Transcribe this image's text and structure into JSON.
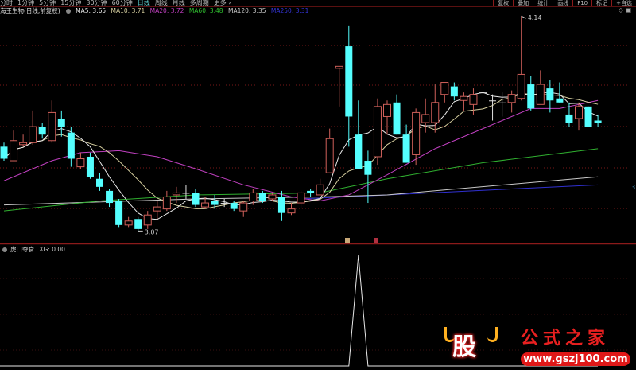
{
  "topbar": {
    "tabs": [
      "分时",
      "1分钟",
      "5分钟",
      "15分钟",
      "30分钟",
      "60分钟",
      "日线",
      "周线",
      "月线",
      "多周期",
      "更多 ›"
    ],
    "active_tab": "日线",
    "tools": [
      "复权",
      "叠加",
      "统计",
      "画线",
      "F10",
      "标记",
      "+自选"
    ]
  },
  "legend": {
    "title": "海王生物(日线,前复权)",
    "ma5": "MA5: 3.65",
    "ma10": "MA10: 3.71",
    "ma20": "MA20: 3.72",
    "ma60": "MA60: 3.48",
    "ma120": "MA120: 3.35",
    "ma250": "MA250: 3.31"
  },
  "colors": {
    "up": "#d0605a",
    "down": "#54ffff",
    "ma5": "#e8e8e8",
    "ma10": "#d8d0a0",
    "ma20": "#c040c0",
    "ma60": "#30b030",
    "ma120": "#c8c8c8",
    "ma250": "#3030d0",
    "grid": "#7a1818"
  },
  "sub_indicator": {
    "title": "虎口夺食",
    "value_label": "XG: 0.00"
  },
  "axis_label_right": "3",
  "watermark": {
    "char": "股",
    "name": "公式之家",
    "url": "www.gszj100.com"
  },
  "chart_data": {
    "type": "candlestick",
    "title": "海王生物(日线,前复权)",
    "ylim": [
      3.0,
      4.2
    ],
    "annotations": [
      {
        "text": "4.14",
        "candle": 54,
        "value": 4.14,
        "kind": "high"
      },
      {
        "text": "3.07",
        "candle": 14,
        "value": 3.07,
        "kind": "low"
      }
    ],
    "ohlc": [
      [
        3.49,
        3.51,
        3.42,
        3.43
      ],
      [
        3.42,
        3.57,
        3.42,
        3.52
      ],
      [
        3.5,
        3.55,
        3.49,
        3.51
      ],
      [
        3.51,
        3.67,
        3.5,
        3.59
      ],
      [
        3.59,
        3.61,
        3.53,
        3.55
      ],
      [
        3.52,
        3.72,
        3.51,
        3.66
      ],
      [
        3.63,
        3.67,
        3.54,
        3.59
      ],
      [
        3.56,
        3.59,
        3.39,
        3.43
      ],
      [
        3.39,
        3.46,
        3.38,
        3.43
      ],
      [
        3.44,
        3.46,
        3.33,
        3.34
      ],
      [
        3.33,
        3.36,
        3.27,
        3.29
      ],
      [
        3.27,
        3.28,
        3.19,
        3.21
      ],
      [
        3.22,
        3.23,
        3.09,
        3.1
      ],
      [
        3.1,
        3.14,
        3.09,
        3.12
      ],
      [
        3.13,
        3.14,
        3.07,
        3.08
      ],
      [
        3.1,
        3.17,
        3.08,
        3.15
      ],
      [
        3.17,
        3.22,
        3.13,
        3.19
      ],
      [
        3.18,
        3.27,
        3.17,
        3.24
      ],
      [
        3.25,
        3.29,
        3.21,
        3.26
      ],
      [
        3.26,
        3.3,
        3.23,
        3.26
      ],
      [
        3.26,
        3.28,
        3.19,
        3.2
      ],
      [
        3.19,
        3.24,
        3.18,
        3.21
      ],
      [
        3.22,
        3.25,
        3.18,
        3.2
      ],
      [
        3.21,
        3.23,
        3.19,
        3.21
      ],
      [
        3.21,
        3.22,
        3.17,
        3.18
      ],
      [
        3.17,
        3.22,
        3.14,
        3.21
      ],
      [
        3.22,
        3.28,
        3.2,
        3.26
      ],
      [
        3.26,
        3.27,
        3.21,
        3.22
      ],
      [
        3.23,
        3.26,
        3.22,
        3.25
      ],
      [
        3.24,
        3.27,
        3.12,
        3.16
      ],
      [
        3.16,
        3.21,
        3.15,
        3.18
      ],
      [
        3.21,
        3.27,
        3.18,
        3.26
      ],
      [
        3.27,
        3.28,
        3.24,
        3.26
      ],
      [
        3.25,
        3.33,
        3.25,
        3.3
      ],
      [
        3.36,
        3.58,
        3.36,
        3.53
      ],
      [
        3.88,
        3.89,
        3.69,
        3.89
      ],
      [
        3.99,
        4.09,
        3.49,
        3.64
      ],
      [
        3.55,
        3.72,
        3.38,
        3.38
      ],
      [
        3.42,
        3.47,
        3.21,
        3.35
      ],
      [
        3.44,
        3.73,
        3.4,
        3.69
      ],
      [
        3.64,
        3.72,
        3.55,
        3.7
      ],
      [
        3.71,
        3.75,
        3.55,
        3.55
      ],
      [
        3.55,
        3.6,
        3.41,
        3.41
      ],
      [
        3.45,
        3.68,
        3.4,
        3.66
      ],
      [
        3.61,
        3.73,
        3.56,
        3.65
      ],
      [
        3.61,
        3.8,
        3.56,
        3.71
      ],
      [
        3.75,
        3.81,
        3.71,
        3.81
      ],
      [
        3.79,
        3.81,
        3.72,
        3.74
      ],
      [
        3.72,
        3.76,
        3.67,
        3.74
      ],
      [
        3.7,
        3.78,
        3.65,
        3.75
      ],
      [
        3.76,
        3.84,
        3.68,
        3.76
      ],
      [
        3.72,
        3.75,
        3.62,
        3.72
      ],
      [
        3.71,
        3.76,
        3.64,
        3.71
      ],
      [
        3.71,
        3.77,
        3.66,
        3.75
      ],
      [
        3.73,
        4.14,
        3.72,
        3.85
      ],
      [
        3.8,
        3.84,
        3.67,
        3.68
      ],
      [
        3.7,
        3.87,
        3.7,
        3.8
      ],
      [
        3.78,
        3.82,
        3.66,
        3.72
      ],
      [
        3.73,
        3.81,
        3.71,
        3.71
      ],
      [
        3.65,
        3.71,
        3.59,
        3.61
      ],
      [
        3.63,
        3.71,
        3.57,
        3.69
      ],
      [
        3.69,
        3.69,
        3.59,
        3.59
      ],
      [
        3.62,
        3.65,
        3.59,
        3.61
      ]
    ],
    "ma_series": {
      "ma20": [
        [
          0,
          3.32
        ],
        [
          5,
          3.42
        ],
        [
          8,
          3.46
        ],
        [
          12,
          3.47
        ],
        [
          16,
          3.44
        ],
        [
          20,
          3.38
        ],
        [
          25,
          3.3
        ],
        [
          30,
          3.24
        ],
        [
          33,
          3.22
        ],
        [
          36,
          3.25
        ],
        [
          40,
          3.35
        ],
        [
          45,
          3.48
        ],
        [
          50,
          3.58
        ],
        [
          55,
          3.68
        ],
        [
          58,
          3.68
        ],
        [
          62,
          3.72
        ]
      ],
      "ma60": [
        [
          0,
          3.17
        ],
        [
          10,
          3.22
        ],
        [
          20,
          3.25
        ],
        [
          33,
          3.26
        ],
        [
          40,
          3.33
        ],
        [
          50,
          3.41
        ],
        [
          62,
          3.48
        ]
      ],
      "ma120": [
        [
          0,
          3.2
        ],
        [
          20,
          3.23
        ],
        [
          33,
          3.24
        ],
        [
          40,
          3.25
        ],
        [
          62,
          3.34
        ]
      ],
      "ma250": [
        [
          31,
          3.23
        ],
        [
          40,
          3.25
        ],
        [
          62,
          3.3
        ]
      ]
    },
    "xg": {
      "signal_candle": 37,
      "values_nonzero": 1,
      "ylim": [
        0,
        1
      ]
    }
  }
}
